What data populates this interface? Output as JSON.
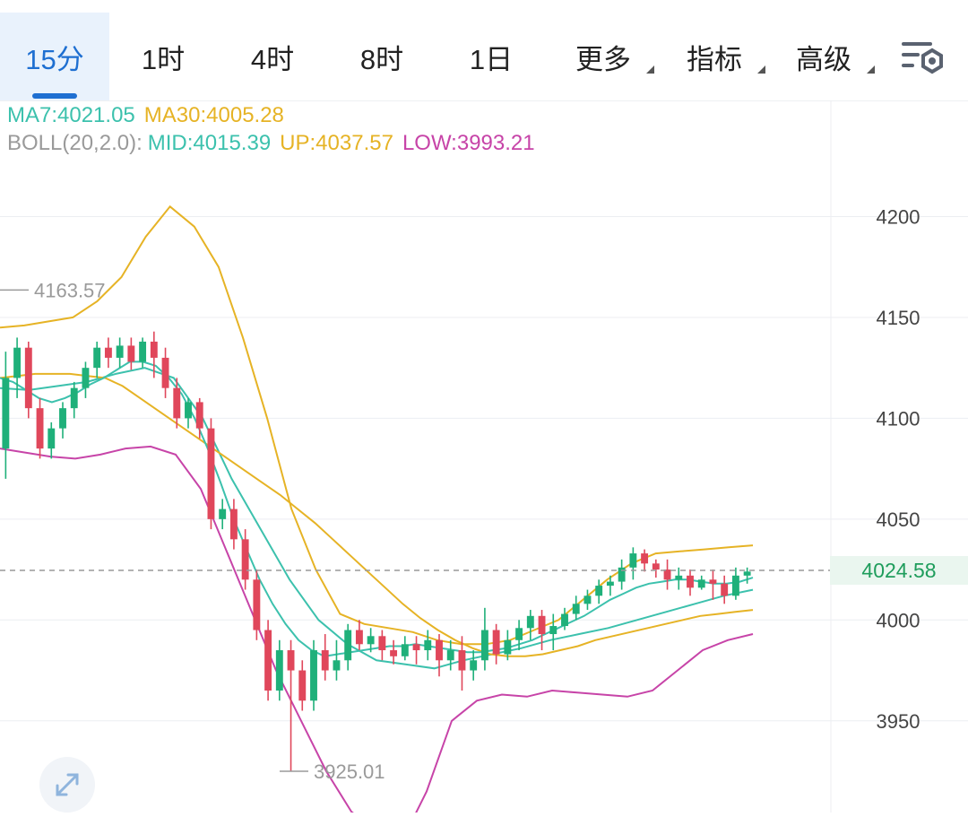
{
  "tabs": [
    {
      "label": "15分",
      "active": true,
      "dropdown": false
    },
    {
      "label": "1时",
      "active": false,
      "dropdown": false
    },
    {
      "label": "4时",
      "active": false,
      "dropdown": false
    },
    {
      "label": "8时",
      "active": false,
      "dropdown": false
    },
    {
      "label": "1日",
      "active": false,
      "dropdown": false
    },
    {
      "label": "更多",
      "active": false,
      "dropdown": true
    },
    {
      "label": "指标",
      "active": false,
      "dropdown": true
    },
    {
      "label": "高级",
      "active": false,
      "dropdown": true
    }
  ],
  "settings_icon": "chart-settings-icon",
  "expand_icon": "expand-arrows-icon",
  "indicators": {
    "ma7": "MA7:4021.05",
    "ma30": "MA30:4005.28",
    "boll_label": "BOLL(20,2.0):",
    "mid": "MID:4015.39",
    "up": "UP:4037.57",
    "low": "LOW:3993.21"
  },
  "colors": {
    "up_candle": "#1fb07a",
    "down_candle": "#e0475b",
    "ma7": "#3cc1ad",
    "ma30": "#e6b325",
    "boll_mid": "#3cc1ad",
    "boll_up": "#e6b325",
    "boll_low": "#c744a8",
    "accent": "#1e6fd1"
  },
  "chart_data": {
    "type": "candlestick",
    "y_ticks": [
      4200,
      4150,
      4100,
      4050,
      4000,
      3950
    ],
    "ylim": [
      3910,
      4220
    ],
    "current_price": 4024.58,
    "current_price_label": "4024.58",
    "high_marker": {
      "value": 4163.57,
      "label": "4163.57"
    },
    "low_marker": {
      "value": 3925.01,
      "label": "3925.01"
    },
    "candles": [
      [
        4085,
        4120,
        4070,
        4133
      ],
      [
        4120,
        4135,
        4110,
        4140
      ],
      [
        4135,
        4105,
        4100,
        4138
      ],
      [
        4105,
        4085,
        4080,
        4110
      ],
      [
        4085,
        4095,
        4080,
        4098
      ],
      [
        4095,
        4105,
        4090,
        4108
      ],
      [
        4105,
        4115,
        4100,
        4118
      ],
      [
        4115,
        4125,
        4110,
        4128
      ],
      [
        4125,
        4135,
        4120,
        4138
      ],
      [
        4135,
        4130,
        4125,
        4140
      ],
      [
        4130,
        4136,
        4125,
        4140
      ],
      [
        4136,
        4128,
        4124,
        4140
      ],
      [
        4128,
        4138,
        4125,
        4140
      ],
      [
        4138,
        4130,
        4120,
        4143
      ],
      [
        4130,
        4115,
        4110,
        4135
      ],
      [
        4115,
        4100,
        4095,
        4120
      ],
      [
        4100,
        4108,
        4095,
        4110
      ],
      [
        4108,
        4095,
        4090,
        4110
      ],
      [
        4095,
        4050,
        4045,
        4100
      ],
      [
        4050,
        4055,
        4045,
        4060
      ],
      [
        4055,
        4040,
        4035,
        4060
      ],
      [
        4040,
        4020,
        4015,
        4045
      ],
      [
        4020,
        3995,
        3990,
        4025
      ],
      [
        3995,
        3965,
        3960,
        4000
      ],
      [
        3965,
        3985,
        3960,
        3990
      ],
      [
        3985,
        3975,
        3925,
        3990
      ],
      [
        3975,
        3960,
        3955,
        3980
      ],
      [
        3960,
        3985,
        3955,
        3990
      ],
      [
        3985,
        3975,
        3970,
        3993
      ],
      [
        3975,
        3980,
        3970,
        3990
      ],
      [
        3980,
        3995,
        3975,
        3998
      ],
      [
        3995,
        3988,
        3985,
        4000
      ],
      [
        3988,
        3992,
        3984,
        3996
      ],
      [
        3992,
        3985,
        3980,
        3995
      ],
      [
        3985,
        3982,
        3978,
        3990
      ],
      [
        3982,
        3988,
        3980,
        3992
      ],
      [
        3988,
        3985,
        3978,
        3992
      ],
      [
        3985,
        3990,
        3980,
        3995
      ],
      [
        3990,
        3980,
        3972,
        3993
      ],
      [
        3980,
        3985,
        3975,
        3990
      ],
      [
        3985,
        3975,
        3965,
        3992
      ],
      [
        3975,
        3980,
        3970,
        3985
      ],
      [
        3980,
        3995,
        3975,
        4006
      ],
      [
        3995,
        3983,
        3978,
        3998
      ],
      [
        3983,
        3990,
        3980,
        3995
      ],
      [
        3990,
        3996,
        3985,
        4000
      ],
      [
        3996,
        4002,
        3990,
        4005
      ],
      [
        4002,
        3993,
        3985,
        4005
      ],
      [
        3993,
        3997,
        3985,
        4003
      ],
      [
        3997,
        4003,
        3995,
        4006
      ],
      [
        4003,
        4008,
        4000,
        4012
      ],
      [
        4008,
        4012,
        4005,
        4015
      ],
      [
        4012,
        4017,
        4008,
        4020
      ],
      [
        4017,
        4019,
        4012,
        4022
      ],
      [
        4019,
        4026,
        4015,
        4030
      ],
      [
        4026,
        4033,
        4020,
        4036
      ],
      [
        4033,
        4028,
        4024,
        4035
      ],
      [
        4028,
        4025,
        4021,
        4030
      ],
      [
        4025,
        4020,
        4015,
        4030
      ],
      [
        4020,
        4022,
        4015,
        4026
      ],
      [
        4022,
        4016,
        4012,
        4025
      ],
      [
        4016,
        4020,
        4015,
        4022
      ],
      [
        4020,
        4018,
        4010,
        4025
      ],
      [
        4018,
        4012,
        4008,
        4022
      ],
      [
        4012,
        4022,
        4010,
        4026
      ],
      [
        4022,
        4024,
        4018,
        4026
      ]
    ],
    "ma7_line": [
      4120,
      4118,
      4114,
      4110,
      4108,
      4110,
      4113,
      4117,
      4120,
      4124,
      4128,
      4128,
      4126,
      4120,
      4112,
      4100,
      4085,
      4068,
      4050,
      4035,
      4020,
      4008,
      3998,
      3990,
      3985,
      3982,
      3983,
      3984,
      3985,
      3986,
      3987,
      3987,
      3988,
      3987,
      3986,
      3985,
      3984,
      3984,
      3985,
      3986,
      3988,
      3990,
      3993,
      3996,
      3999,
      4002,
      4006,
      4010,
      4013,
      4016,
      4018,
      4019,
      4020,
      4020,
      4019,
      4018,
      4018,
      4019,
      4021
    ],
    "ma30_line": [
      4120,
      4121,
      4122,
      4122,
      4122,
      4121,
      4120,
      4116,
      4110,
      4104,
      4098,
      4092,
      4086,
      4080,
      4074,
      4068,
      4062,
      4055,
      4048,
      4040,
      4032,
      4024,
      4016,
      4008,
      4001,
      3995,
      3990,
      3986,
      3983,
      3982,
      3982,
      3983,
      3985,
      3987,
      3990,
      3992,
      3994,
      3996,
      3998,
      4000,
      4002,
      4003,
      4004,
      4005
    ],
    "boll_up_line": [
      4145,
      4146,
      4148,
      4150,
      4158,
      4170,
      4190,
      4205,
      4195,
      4175,
      4140,
      4100,
      4055,
      4025,
      4003,
      3998,
      3996,
      3994,
      3990,
      3988,
      3988,
      3990,
      3995,
      4000,
      4010,
      4020,
      4028,
      4033,
      4034,
      4035,
      4036,
      4037
    ],
    "boll_low_line": [
      4085,
      4083,
      4081,
      4080,
      4082,
      4085,
      4086,
      4082,
      4065,
      4035,
      4005,
      3975,
      3950,
      3925,
      3905,
      3895,
      3890,
      3915,
      3950,
      3960,
      3963,
      3962,
      3965,
      3964,
      3963,
      3962,
      3965,
      3975,
      3985,
      3990,
      3993
    ],
    "boll_mid_line": [
      4115,
      4114,
      4116,
      4118,
      4122,
      4125,
      4120,
      4100,
      4070,
      4045,
      4020,
      4000,
      3988,
      3980,
      3978,
      3976,
      3980,
      3983,
      3986,
      3990,
      3993,
      3996,
      4000,
      4004,
      4008,
      4012,
      4015
    ]
  }
}
